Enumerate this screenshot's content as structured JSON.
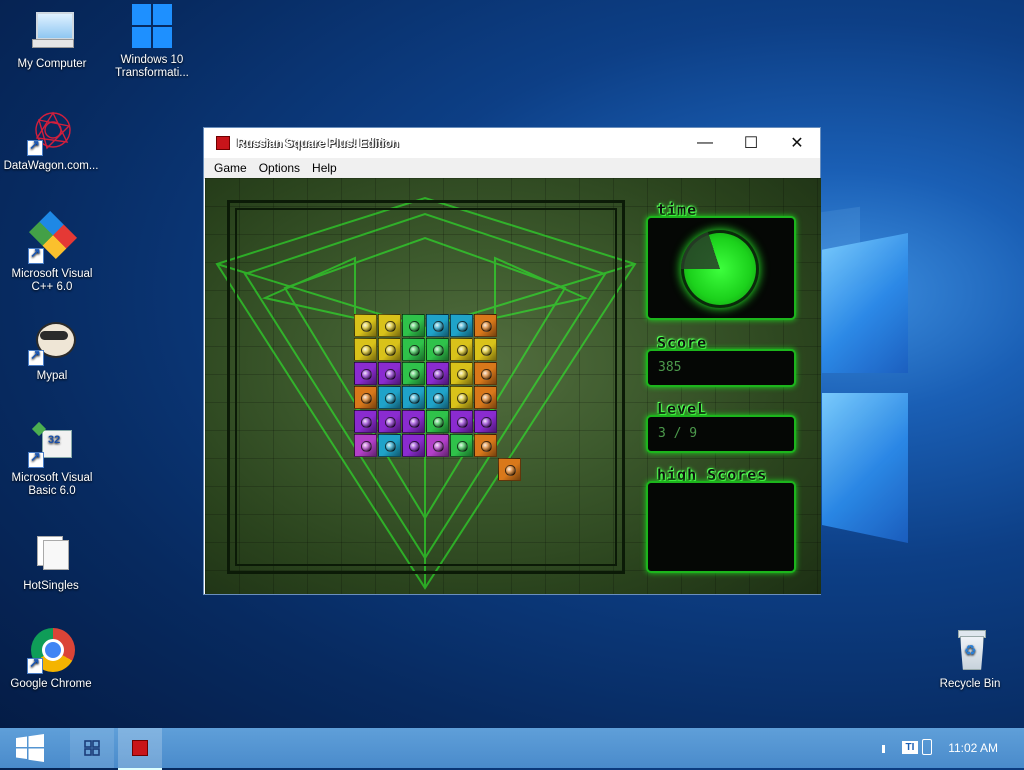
{
  "desktop": {
    "icons": [
      {
        "label": "My Computer"
      },
      {
        "label": "Windows 10 Transformati..."
      },
      {
        "label": "DataWagon.com..."
      },
      {
        "label": "Microsoft Visual C++ 6.0"
      },
      {
        "label": "Mypal"
      },
      {
        "label": "Microsoft Visual Basic 6.0"
      },
      {
        "label": "HotSingles"
      },
      {
        "label": "Google Chrome"
      },
      {
        "label": "Recycle Bin"
      }
    ]
  },
  "window": {
    "title": "Russian Square Plus! Edition",
    "controls": {
      "minimize": "—",
      "maximize": "☐",
      "close": "✕"
    },
    "menu": [
      "Game",
      "Options",
      "Help"
    ]
  },
  "game": {
    "time_label": "time",
    "time_remaining_fraction": 0.8,
    "score_label": "Score",
    "score": "385",
    "level_label": "LeveL",
    "level": "3 / 9",
    "high_scores_label": "high Scores",
    "colors": {
      "yellow": "#d9c21a",
      "green": "#2fc24a",
      "cyan": "#1fa3c9",
      "orange": "#d9781a",
      "purple": "#8a2bd0",
      "magenta": "#b23fc9"
    },
    "board_rows": [
      [
        "yellow",
        "yellow",
        "green",
        "cyan",
        "cyan",
        "orange"
      ],
      [
        "yellow",
        "yellow",
        "green",
        "green",
        "yellow",
        "yellow"
      ],
      [
        "purple",
        "purple",
        "green",
        "purple",
        "yellow",
        "orange"
      ],
      [
        "orange",
        "cyan",
        "cyan",
        "cyan",
        "yellow",
        "orange"
      ],
      [
        "purple",
        "purple",
        "purple",
        "green",
        "purple",
        "purple"
      ],
      [
        "magenta",
        "cyan",
        "purple",
        "magenta",
        "green",
        "orange"
      ]
    ],
    "falling_piece": "orange"
  },
  "taskbar": {
    "start_icon": "windows-logo-icon",
    "clock": "11:02 AM"
  }
}
